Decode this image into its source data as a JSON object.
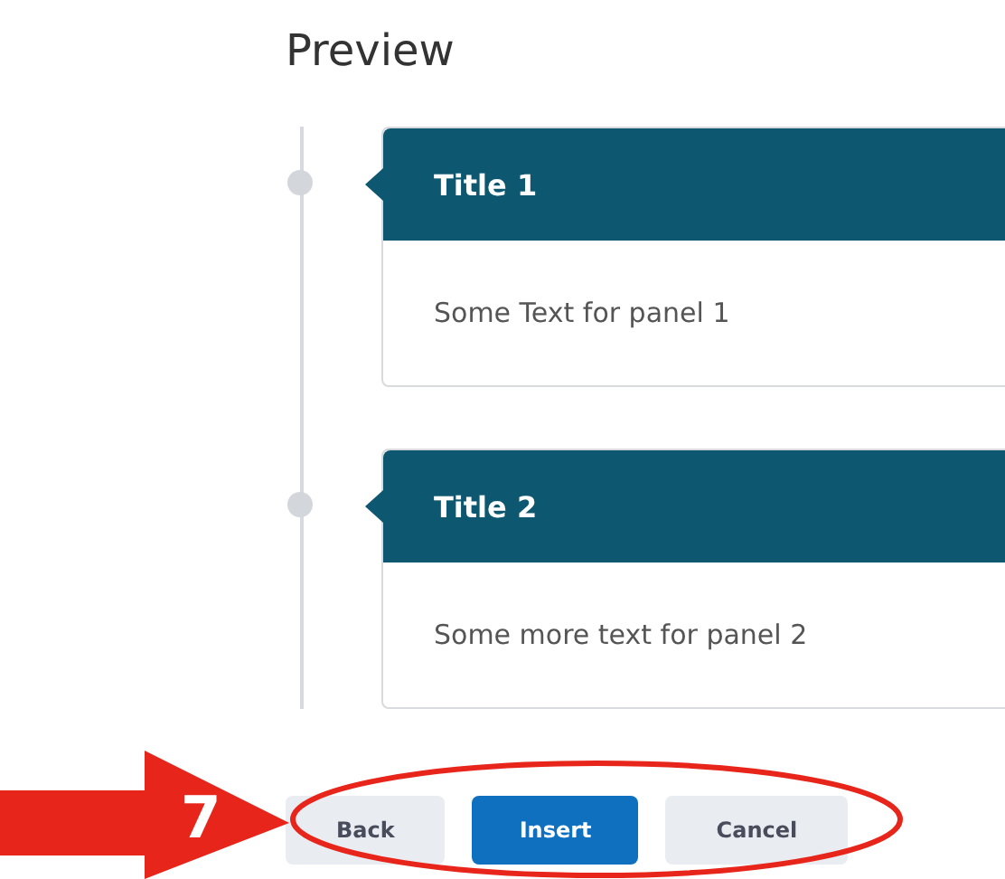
{
  "heading": "Preview",
  "panels": [
    {
      "title": "Title 1",
      "text": "Some Text for panel 1"
    },
    {
      "title": "Title 2",
      "text": "Some more text for panel 2"
    }
  ],
  "buttons": [
    {
      "label": "Back",
      "kind": "secondary"
    },
    {
      "label": "Insert",
      "kind": "primary"
    },
    {
      "label": "Cancel",
      "kind": "secondary"
    }
  ],
  "annotation": {
    "number": "7"
  }
}
